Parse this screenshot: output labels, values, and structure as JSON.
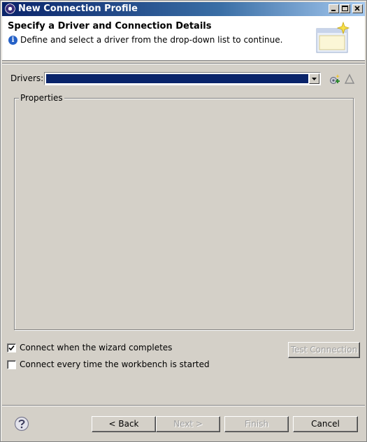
{
  "window": {
    "title": "New Connection Profile"
  },
  "banner": {
    "title": "Specify a Driver and Connection Details",
    "message": "Define and select a driver from the drop-down list to continue."
  },
  "drivers": {
    "label": "Drivers:",
    "selected_value": ""
  },
  "properties": {
    "legend": "Properties"
  },
  "options": {
    "connect_on_complete": {
      "label": "Connect when the wizard completes",
      "checked": true
    },
    "connect_on_startup": {
      "label": "Connect every time the workbench is started",
      "checked": false
    },
    "test_connection_label": "Test Connection"
  },
  "buttons": {
    "back": "< Back",
    "next": "Next >",
    "finish": "Finish",
    "cancel": "Cancel"
  },
  "icons": {
    "app": "eclipse-icon",
    "info": "info-icon",
    "help": "help-icon",
    "new_driver": "new-driver-icon",
    "edit_driver": "edit-driver-icon"
  },
  "colors": {
    "titlebar_start": "#0a246a",
    "titlebar_end": "#a6caf0",
    "dialog_bg": "#d4d0c8",
    "selection": "#0a246a"
  }
}
